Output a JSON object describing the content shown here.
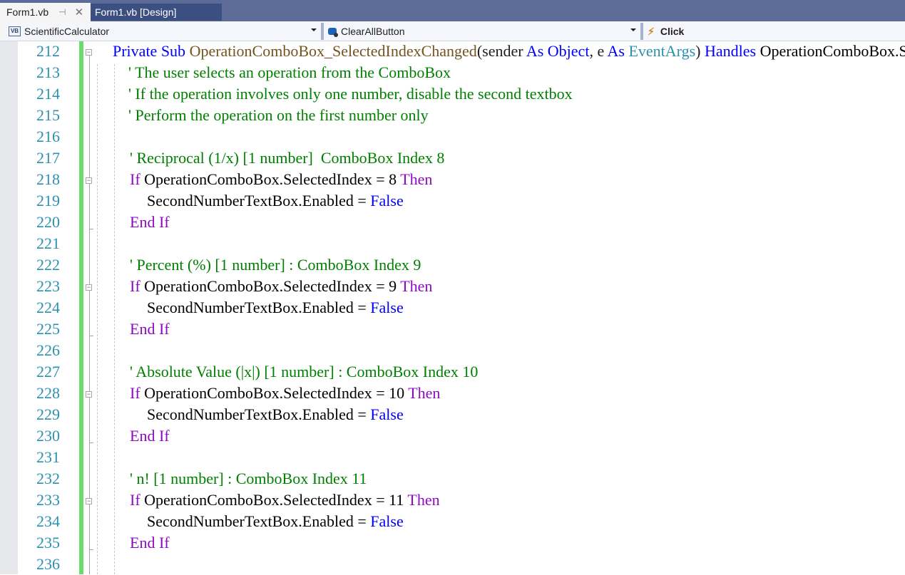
{
  "tabs": [
    {
      "label": "Form1.vb",
      "active": true,
      "pin_icon": "pin-icon",
      "close_icon": "close-icon"
    },
    {
      "label": "Form1.vb [Design]",
      "active": false
    }
  ],
  "navbar": {
    "project": {
      "icon": "vb-project-icon",
      "icon_text": "VB",
      "label": "ScientificCalculator"
    },
    "object": {
      "icon": "control-icon",
      "label": "ClearAllButton"
    },
    "event": {
      "icon": "event-bolt-icon",
      "label": "Click"
    }
  },
  "colors": {
    "keyword": "#0000ff",
    "control_keyword": "#8f08c4",
    "comment": "#008000",
    "method": "#74531f",
    "type": "#2b91af",
    "line_number": "#2b91af",
    "change_bar": "#6bdc6b",
    "tab_bar": "#5d6b99"
  },
  "editor": {
    "lines": [
      {
        "n": "212",
        "tokens": [
          {
            "t": "Private Sub ",
            "c": "kw"
          },
          {
            "t": "OperationComboBox_SelectedIndexChanged",
            "c": "mth"
          },
          {
            "t": "(sender ",
            "c": "pl"
          },
          {
            "t": "As ",
            "c": "kw"
          },
          {
            "t": "Object",
            "c": "kw"
          },
          {
            "t": ", e ",
            "c": "pl"
          },
          {
            "t": "As ",
            "c": "kw"
          },
          {
            "t": "EventArgs",
            "c": "ty"
          },
          {
            "t": ") ",
            "c": "pl"
          },
          {
            "t": "Handles ",
            "c": "kw"
          },
          {
            "t": "OperationComboBox.SelectedIndexChanged",
            "c": "id"
          }
        ]
      },
      {
        "n": "213",
        "tokens": [
          {
            "t": "' The user selects an operation from the ComboBox",
            "c": "cm"
          }
        ]
      },
      {
        "n": "214",
        "tokens": [
          {
            "t": "' If the operation involves only one number, disable the second textbox",
            "c": "cm"
          }
        ]
      },
      {
        "n": "215",
        "tokens": [
          {
            "t": "' Perform the operation on the first number only",
            "c": "cm"
          }
        ]
      },
      {
        "n": "216",
        "tokens": []
      },
      {
        "n": "217",
        "tokens": [
          {
            "t": "' Reciprocal (1/x) [1 number]  ComboBox Index 8",
            "c": "cm"
          }
        ]
      },
      {
        "n": "218",
        "tokens": [
          {
            "t": "If ",
            "c": "ctl"
          },
          {
            "t": "OperationComboBox.SelectedIndex = 8 ",
            "c": "id"
          },
          {
            "t": "Then",
            "c": "ctl"
          }
        ]
      },
      {
        "n": "219",
        "tokens": [
          {
            "t": "SecondNumberTextBox.Enabled = ",
            "c": "id"
          },
          {
            "t": "False",
            "c": "kw"
          }
        ]
      },
      {
        "n": "220",
        "tokens": [
          {
            "t": "End If",
            "c": "ctl"
          }
        ]
      },
      {
        "n": "221",
        "tokens": []
      },
      {
        "n": "222",
        "tokens": [
          {
            "t": "' Percent (%) [1 number] : ComboBox Index 9",
            "c": "cm"
          }
        ]
      },
      {
        "n": "223",
        "tokens": [
          {
            "t": "If ",
            "c": "ctl"
          },
          {
            "t": "OperationComboBox.SelectedIndex = 9 ",
            "c": "id"
          },
          {
            "t": "Then",
            "c": "ctl"
          }
        ]
      },
      {
        "n": "224",
        "tokens": [
          {
            "t": "SecondNumberTextBox.Enabled = ",
            "c": "id"
          },
          {
            "t": "False",
            "c": "kw"
          }
        ]
      },
      {
        "n": "225",
        "tokens": [
          {
            "t": "End If",
            "c": "ctl"
          }
        ]
      },
      {
        "n": "226",
        "tokens": []
      },
      {
        "n": "227",
        "tokens": [
          {
            "t": "' Absolute Value (|x|) [1 number] : ComboBox Index 10",
            "c": "cm"
          }
        ]
      },
      {
        "n": "228",
        "tokens": [
          {
            "t": "If ",
            "c": "ctl"
          },
          {
            "t": "OperationComboBox.SelectedIndex = 10 ",
            "c": "id"
          },
          {
            "t": "Then",
            "c": "ctl"
          }
        ]
      },
      {
        "n": "229",
        "tokens": [
          {
            "t": "SecondNumberTextBox.Enabled = ",
            "c": "id"
          },
          {
            "t": "False",
            "c": "kw"
          }
        ]
      },
      {
        "n": "230",
        "tokens": [
          {
            "t": "End If",
            "c": "ctl"
          }
        ]
      },
      {
        "n": "231",
        "tokens": []
      },
      {
        "n": "232",
        "tokens": [
          {
            "t": "' n! [1 number] : ComboBox Index 11",
            "c": "cm"
          }
        ]
      },
      {
        "n": "233",
        "tokens": [
          {
            "t": "If ",
            "c": "ctl"
          },
          {
            "t": "OperationComboBox.SelectedIndex = 11 ",
            "c": "id"
          },
          {
            "t": "Then",
            "c": "ctl"
          }
        ]
      },
      {
        "n": "234",
        "tokens": [
          {
            "t": "SecondNumberTextBox.Enabled = ",
            "c": "id"
          },
          {
            "t": "False",
            "c": "kw"
          }
        ]
      },
      {
        "n": "235",
        "tokens": [
          {
            "t": "End If",
            "c": "ctl"
          }
        ]
      },
      {
        "n": "236",
        "tokens": []
      }
    ]
  }
}
